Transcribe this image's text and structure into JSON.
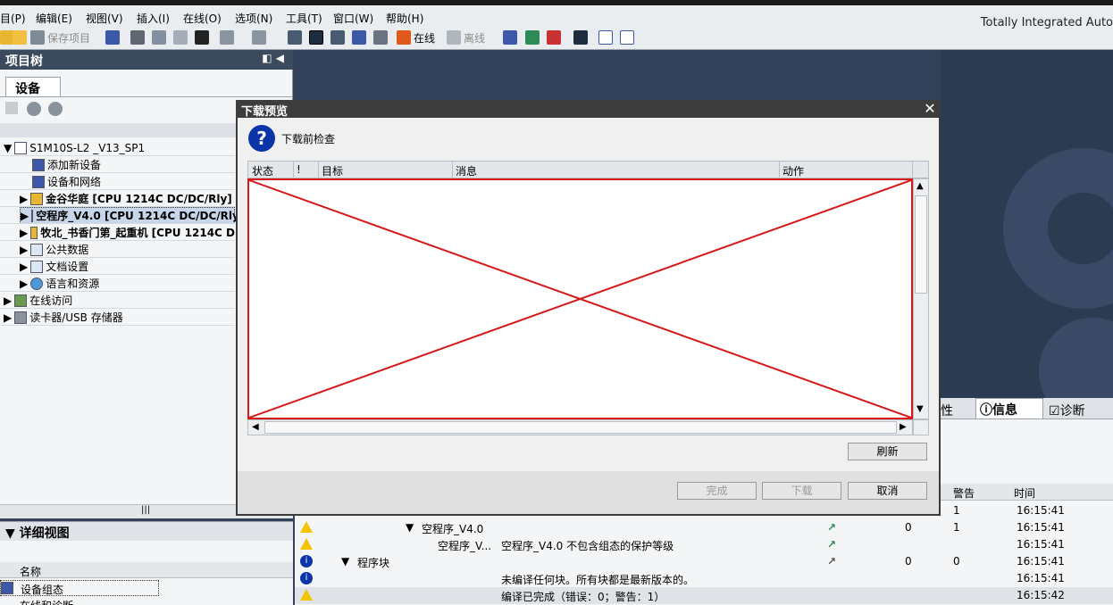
{
  "menu": [
    "目(P)",
    "编辑(E)",
    "视图(V)",
    "插入(I)",
    "在线(O)",
    "选项(N)",
    "工具(T)",
    "窗口(W)",
    "帮助(H)"
  ],
  "brand": "Totally Integrated Auto",
  "toolbar": {
    "save_label": "保存项目",
    "online_label": "在线",
    "offline_label": "离线"
  },
  "tree": {
    "header": "项目树",
    "tab": "设备",
    "items": [
      "S1M10S-L2 _V13_SP1",
      "添加新设备",
      "设备和网络",
      "金谷华庭 [CPU 1214C DC/DC/Rly]",
      "空程序_V4.0 [CPU 1214C DC/DC/Rly]",
      "牧北_书香门第_起重机 [CPU 1214C D",
      "公共数据",
      "文档设置",
      "语言和资源",
      "在线访问",
      "读卡器/USB 存储器"
    ]
  },
  "detail": {
    "header": "详细视图",
    "col_name": "名称",
    "row1": "设备组态",
    "row2": "在线和诊断"
  },
  "dialog": {
    "title": "下载预览",
    "heading": "下载前检查",
    "columns": [
      "状态",
      "!",
      "目标",
      "消息",
      "动作"
    ],
    "refresh": "刷新",
    "finish": "完成",
    "download": "下载",
    "cancel": "取消"
  },
  "info_tabs": {
    "properties": "性",
    "info": "信息",
    "diagnostics": "诊断"
  },
  "info_cols": {
    "warnings": "警告",
    "time": "时间"
  },
  "info_rows": [
    {
      "path": "",
      "msg": "",
      "err": "",
      "warn": "1",
      "time": "16:15:41"
    },
    {
      "path": "空程序_V4.0",
      "msg": "",
      "err": "0",
      "warn": "1",
      "time": "16:15:41"
    },
    {
      "path": "空程序_V...",
      "msg": "空程序_V4.0 不包含组态的保护等级",
      "err": "",
      "warn": "",
      "time": "16:15:41"
    },
    {
      "path": "程序块",
      "msg": "",
      "err": "0",
      "warn": "0",
      "time": "16:15:41"
    },
    {
      "path": "",
      "msg": "未编译任何块。所有块都是最新版本的。",
      "err": "",
      "warn": "",
      "time": "16:15:41"
    },
    {
      "path": "",
      "msg": "编译已完成（错误：0；警告：1）",
      "err": "",
      "warn": "",
      "time": "16:15:42"
    }
  ],
  "colors": {
    "accent": "#0a35a8",
    "warn": "#f5c400",
    "error_frame": "#d61818"
  }
}
